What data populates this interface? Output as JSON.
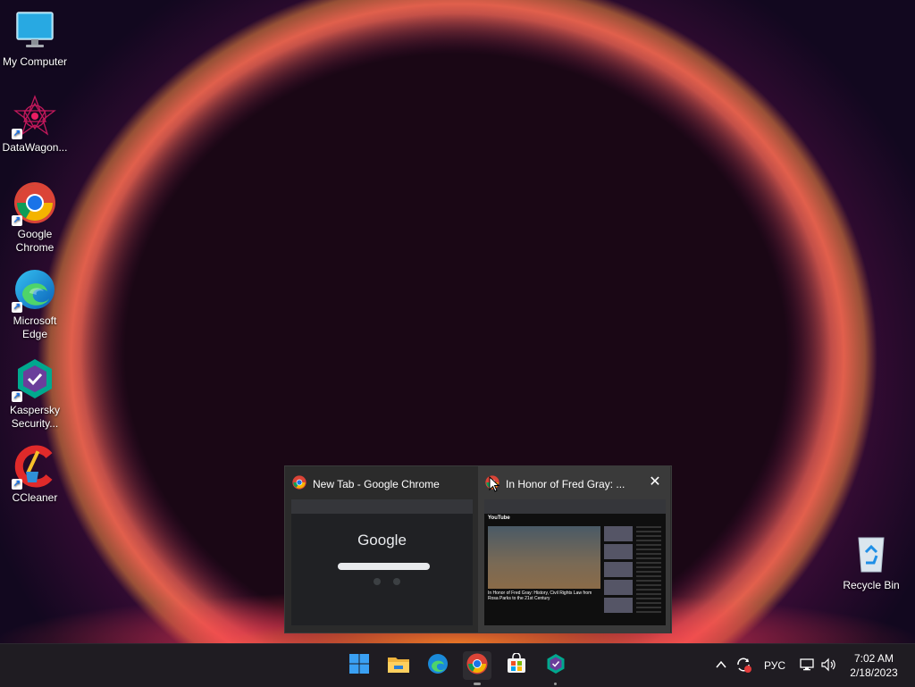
{
  "desktop": {
    "icons": [
      {
        "label": "My Computer"
      },
      {
        "label": "DataWagon..."
      },
      {
        "label": "Google Chrome"
      },
      {
        "label": "Microsoft Edge"
      },
      {
        "label": "Kaspersky Security..."
      },
      {
        "label": "CCleaner"
      },
      {
        "label": "Recycle Bin"
      }
    ]
  },
  "preview": {
    "windows": [
      {
        "title": "New Tab - Google Chrome",
        "thumb_text": "Google"
      },
      {
        "title": "In Honor of Fred Gray: ...",
        "thumb_caption": "In Honor of Fred Gray: History, Civil Rights Law from Rosa Parks to the 21st Century",
        "thumb_logo": "YouTube"
      }
    ],
    "close_glyph": "✕"
  },
  "taskbar": {
    "apps": [
      "start-icon",
      "file-explorer-icon",
      "edge-icon",
      "chrome-icon",
      "microsoft-store-icon",
      "kaspersky-icon"
    ],
    "tray": {
      "language": "РУС",
      "time": "7:02 AM",
      "date": "2/18/2023"
    }
  },
  "colors": {
    "taskbar_bg": "#1f1c22",
    "accent_blue": "#1a73e8"
  }
}
